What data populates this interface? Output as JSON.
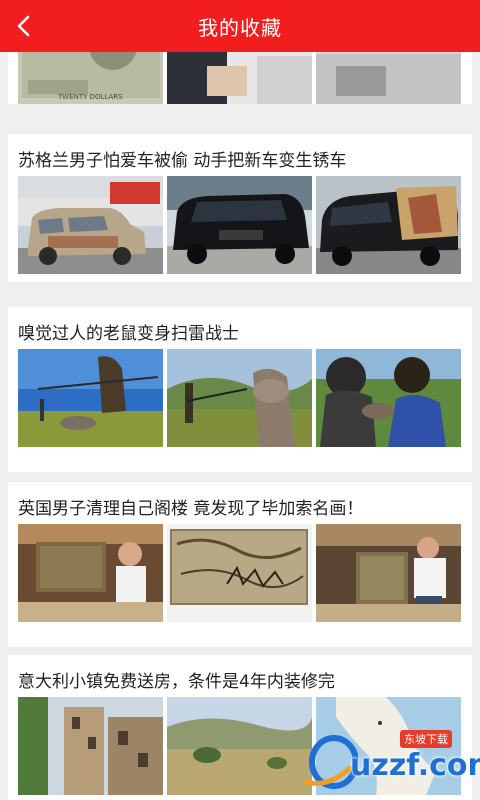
{
  "header": {
    "title": "我的收藏",
    "back_icon": "chevron-left-icon",
    "bg_color": "#f21d1d"
  },
  "cards": [
    {
      "title": "苏格兰男子怕爱车被偷 动手把新车变生锈车"
    },
    {
      "title": "嗅觉过人的老鼠变身扫雷战士"
    },
    {
      "title": "英国男子清理自己阁楼 竟发现了毕加索名画！"
    },
    {
      "title": "意大利小镇免费送房，条件是4年内装修完"
    }
  ],
  "partial_card": {
    "banknote_text": "TWENTY DOLLARS"
  },
  "watermark": {
    "text": "uzzf.com",
    "tag": "东坡下载"
  }
}
